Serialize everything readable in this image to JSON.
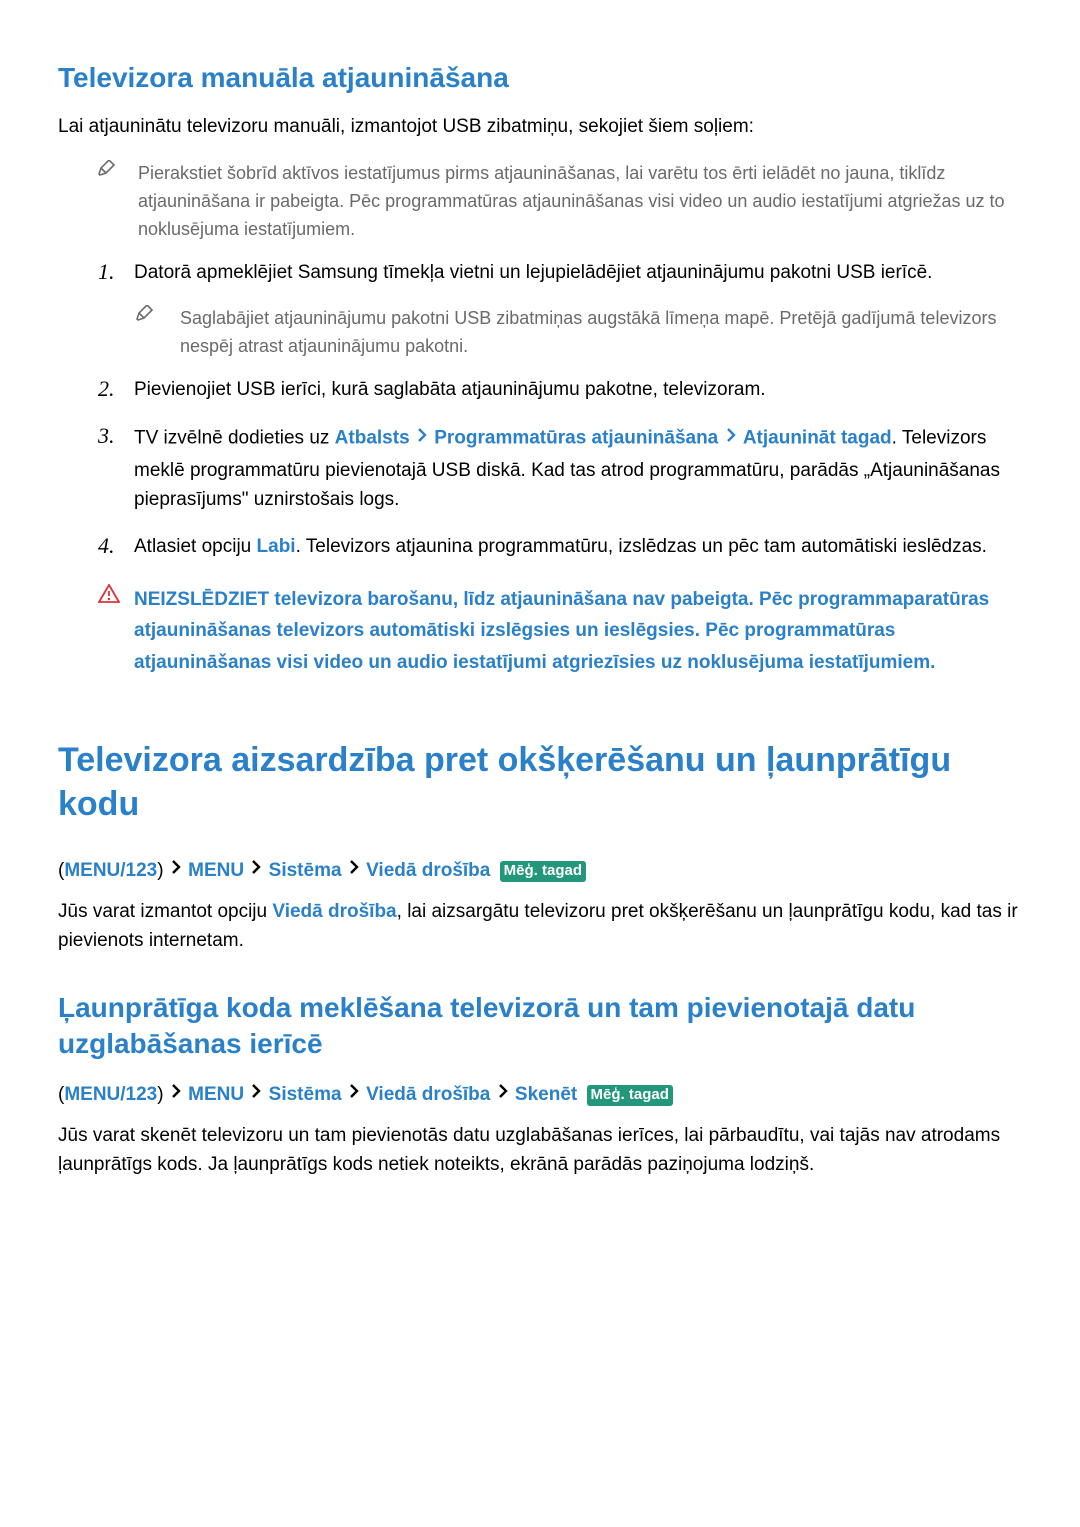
{
  "sec1": {
    "title": "Televizora manuāla atjaunināšana",
    "intro": "Lai atjauninātu televizoru manuāli, izmantojot USB zibatmiņu, sekojiet šiem soļiem:",
    "note1": "Pierakstiet šobrīd aktīvos iestatījumus pirms atjaunināšanas, lai varētu tos ērti ielādēt no jauna, tiklīdz atjaunināšana ir pabeigta. Pēc programmatūras atjaunināšanas visi video un audio iestatījumi atgriežas uz to noklusējuma iestatījumiem.",
    "step1_pre": "Datorā apmeklējiet Samsung tīmekļa vietni un lejupielādējiet atjauninājumu pakotni USB ierīcē.",
    "step1_note": "Saglabājiet atjauninājumu pakotni USB zibatmiņas augstākā līmeņa mapē. Pretējā gadījumā televizors nespēj atrast atjauninājumu pakotni.",
    "step2": "Pievienojiet USB ierīci, kurā saglabāta atjauninājumu pakotne, televizoram.",
    "step3_pre": "TV izvēlnē dodieties uz ",
    "step3_b1": "Atbalsts",
    "step3_b2": "Programmatūras atjaunināšana",
    "step3_b3": "Atjaunināt tagad",
    "step3_post": ". Televizors meklē programmatūru pievienotajā USB diskā. Kad tas atrod programmatūru, parādās „Atjaunināšanas pieprasījums\" uznirstošais logs.",
    "step4_pre": "Atlasiet opciju ",
    "step4_b1": "Labi",
    "step4_post": ". Televizors atjaunina programmatūru, izslēdzas un pēc tam automātiski ieslēdzas.",
    "warning": "NEIZSLĒDZIET televizora barošanu, līdz atjaunināšana nav pabeigta. Pēc programmaparatūras atjaunināšanas televizors automātiski izslēgsies un ieslēgsies. Pēc programmatūras atjaunināšanas visi video un audio iestatījumi atgriezīsies uz noklusējuma iestatījumiem.",
    "nums": {
      "n1": "1.",
      "n2": "2.",
      "n3": "3.",
      "n4": "4."
    }
  },
  "sec2": {
    "title": "Televizora aizsardzība pret okšķerēšanu un ļaunprātīgu kodu",
    "bc": {
      "p1": "MENU/123",
      "p2": "MENU",
      "p3": "Sistēma",
      "p4": "Viedā drošība",
      "try": "Mēģ. tagad"
    },
    "body_pre": "Jūs varat izmantot opciju ",
    "body_hl": "Viedā drošība",
    "body_post": ", lai aizsargātu televizoru pret okšķerēšanu un ļaunprātīgu kodu, kad tas ir pievienots internetam."
  },
  "sec3": {
    "title": "Ļaunprātīga koda meklēšana televizorā un tam pievienotajā datu uzglabāšanas ierīcē",
    "bc": {
      "p1": "MENU/123",
      "p2": "MENU",
      "p3": "Sistēma",
      "p4": "Viedā drošība",
      "p5": "Skenēt",
      "try": "Mēģ. tagad"
    },
    "body": "Jūs varat skenēt televizoru un tam pievienotās datu uzglabāšanas ierīces, lai pārbaudītu, vai tajās nav atrodams ļaunprātīgs kods. Ja ļaunprātīgs kods netiek noteikts, ekrānā parādās paziņojuma lodziņš."
  },
  "glyphs": {
    "lparen": "(",
    "rparen": ") "
  }
}
